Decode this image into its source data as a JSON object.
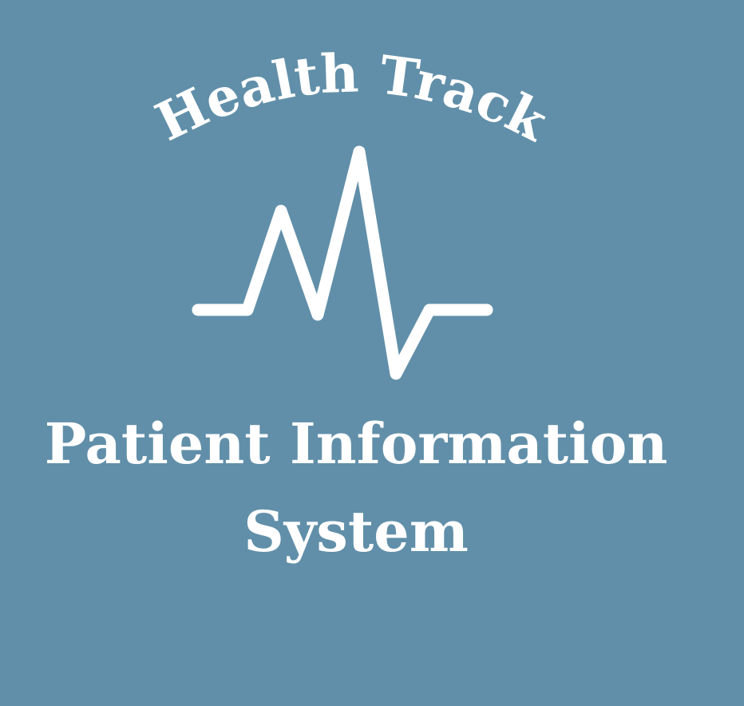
{
  "brand": {
    "name": "Health Track",
    "logo_icon": "heartbeat-pulse-icon",
    "subtitle_line_1": "Patient Information",
    "subtitle_line_2": "System"
  },
  "colors": {
    "background": "#618fa9",
    "foreground": "#ffffff"
  }
}
